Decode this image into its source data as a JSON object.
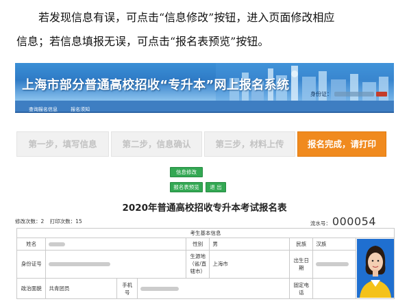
{
  "intro": {
    "line1": "若发现信息有误，可点击“信息修改”按钮，进入页面修改相应",
    "line2": "信息；若信息填报无误，可点击“报名表预览”按钮。"
  },
  "banner": {
    "title": "上海市部分普通高校招收“专升本”网上报名系统",
    "user_label": "身份证：",
    "colors": {
      "top": "#3a8fd6",
      "bottom": "#8cc3ee"
    }
  },
  "nav": {
    "items": [
      "查询报名信息",
      "报名须知"
    ]
  },
  "steps": [
    {
      "label": "第一步，填写信息",
      "active": false
    },
    {
      "label": "第二步，信息确认",
      "active": false
    },
    {
      "label": "第三步，材料上传",
      "active": false
    },
    {
      "label": "报名完成，请打印",
      "active": true
    }
  ],
  "buttons": {
    "edit": "信息修改",
    "preview": "报名表预览",
    "exit": "退 出"
  },
  "form": {
    "title": "2020年普通高校招收专升本考试报名表",
    "edit_count": "修改次数：2",
    "print_count": "打印次数：15",
    "serial_label": "流水号：",
    "serial_number": "000054",
    "section_title": "考生基本信息",
    "labels": {
      "name": "姓名",
      "gender": "性别",
      "ethnicity": "民族",
      "id_number": "身份证号",
      "origin": "生源地（省/直辖市）",
      "birthdate": "出生日期",
      "political": "政治面貌",
      "mobile": "手机号",
      "landline": "固定电话"
    },
    "values": {
      "gender": "男",
      "ethnicity": "汉族",
      "origin": "上海市",
      "political": "共青团员"
    }
  },
  "accent_colors": {
    "step_active": "#f08a1e",
    "button_green": "#33a853",
    "nav_blue": "#3e7ec2"
  }
}
